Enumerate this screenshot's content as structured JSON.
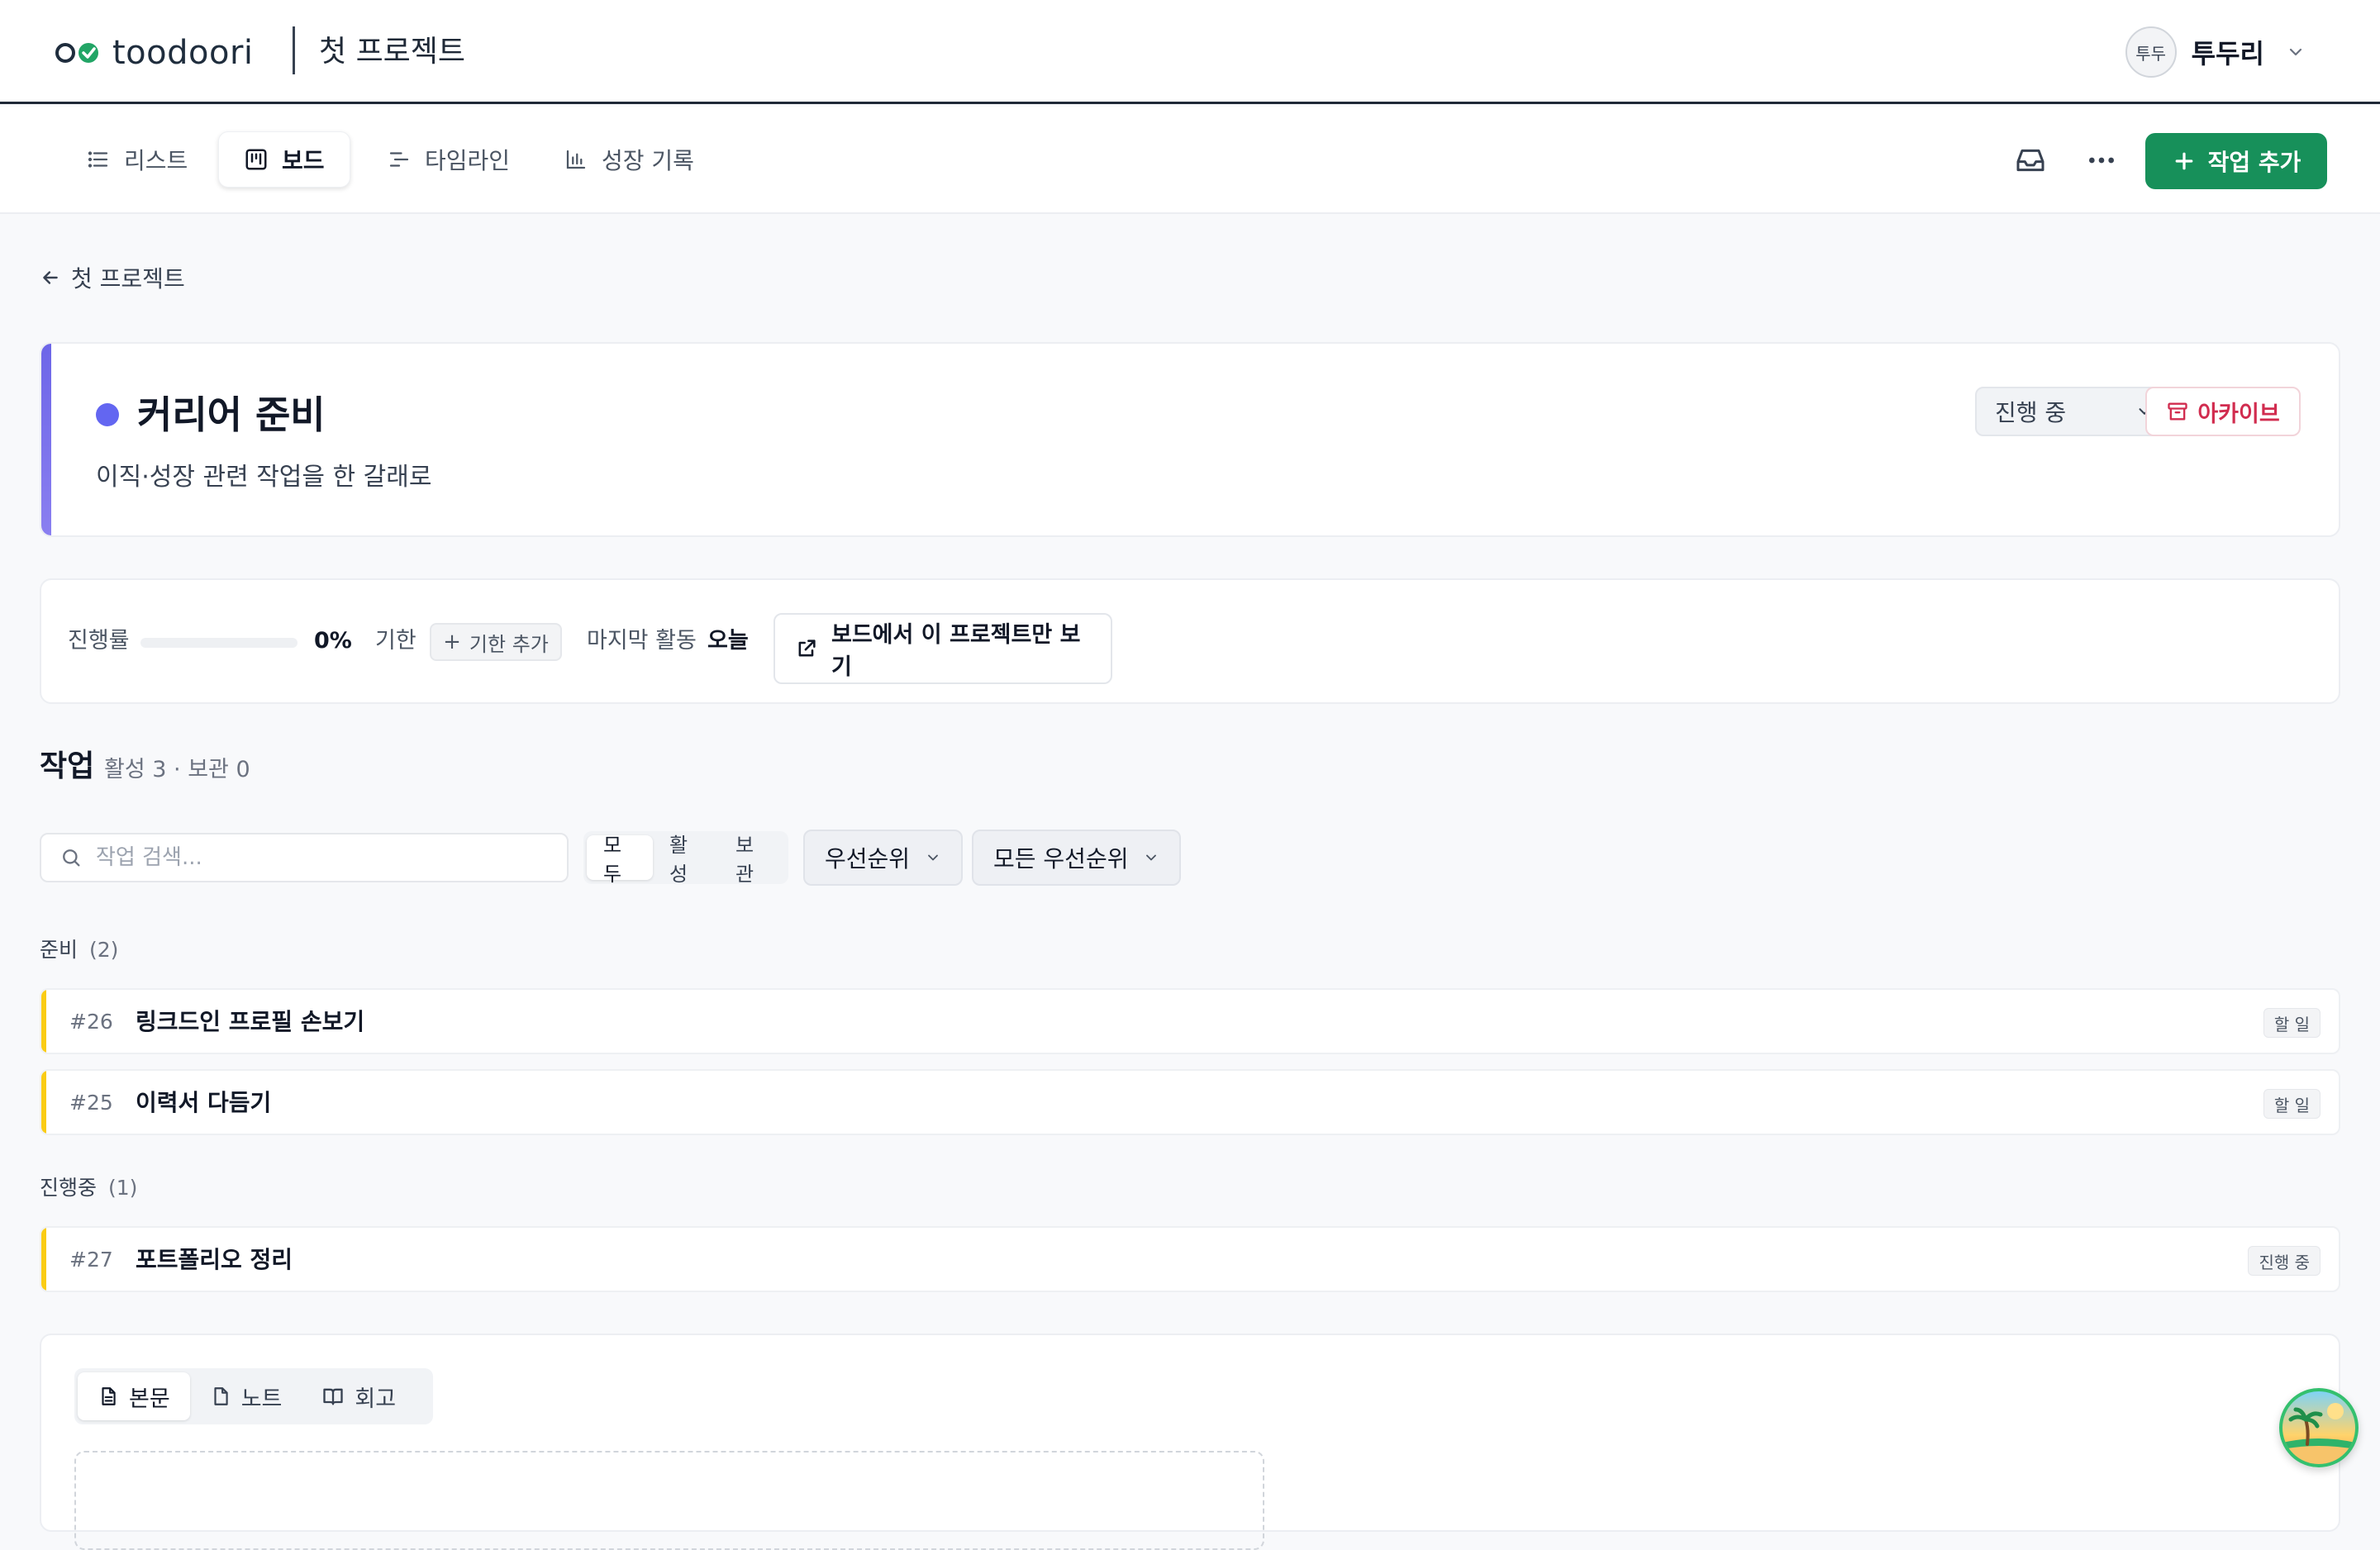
{
  "app": {
    "brand": "toodoori",
    "project_title": "첫 프로젝트",
    "user": {
      "avatar_text": "투두",
      "name": "투두리"
    }
  },
  "nav": {
    "tabs": [
      {
        "label": "리스트",
        "icon": "list-icon",
        "active": false
      },
      {
        "label": "보드",
        "icon": "board-icon",
        "active": true
      },
      {
        "label": "타임라인",
        "icon": "timeline-icon",
        "active": false
      },
      {
        "label": "성장 기록",
        "icon": "chart-icon",
        "active": false
      }
    ],
    "inbox_icon": "inbox-icon",
    "more_icon": "more-icon",
    "add_task_label": "작업 추가"
  },
  "back_link": "첫 프로젝트",
  "project": {
    "name": "커리어 준비",
    "description": "이직·성장 관련 작업을 한 갈래로",
    "status": "진행 중",
    "archive_label": "아카이브",
    "color": "#6366f1"
  },
  "stats": {
    "progress_label": "진행률",
    "progress_value": "0%",
    "progress_fraction": 0,
    "deadline_label": "기한",
    "add_deadline_label": "기한 추가",
    "last_activity_label": "마지막 활동",
    "last_activity_value": "오늘",
    "board_link_label": "보드에서 이 프로젝트만 보기"
  },
  "tasks_section": {
    "title": "작업",
    "meta": "활성 3 · 보관 0",
    "search_placeholder": "작업 검색...",
    "filters": [
      {
        "label": "모두",
        "active": true
      },
      {
        "label": "활성",
        "active": false
      },
      {
        "label": "보관",
        "active": false
      }
    ],
    "sort_label": "우선순위",
    "priority_filter_label": "모든 우선순위"
  },
  "groups": [
    {
      "name": "준비",
      "count": "(2)",
      "tasks": [
        {
          "id": "#26",
          "title": "링크드인 프로필 손보기",
          "status": "할 일"
        },
        {
          "id": "#25",
          "title": "이력서 다듬기",
          "status": "할 일"
        }
      ]
    },
    {
      "name": "진행중",
      "count": "(1)",
      "tasks": [
        {
          "id": "#27",
          "title": "포트폴리오 정리",
          "status": "진행 중"
        }
      ]
    }
  ],
  "editor": {
    "tabs": [
      {
        "label": "본문",
        "icon": "document-icon",
        "active": true
      },
      {
        "label": "노트",
        "icon": "note-icon",
        "active": false
      },
      {
        "label": "회고",
        "icon": "book-icon",
        "active": false
      }
    ]
  },
  "colors": {
    "accent_green": "#17905a",
    "task_bar_yellow": "#facc15",
    "archive_red": "#d12c4f"
  }
}
